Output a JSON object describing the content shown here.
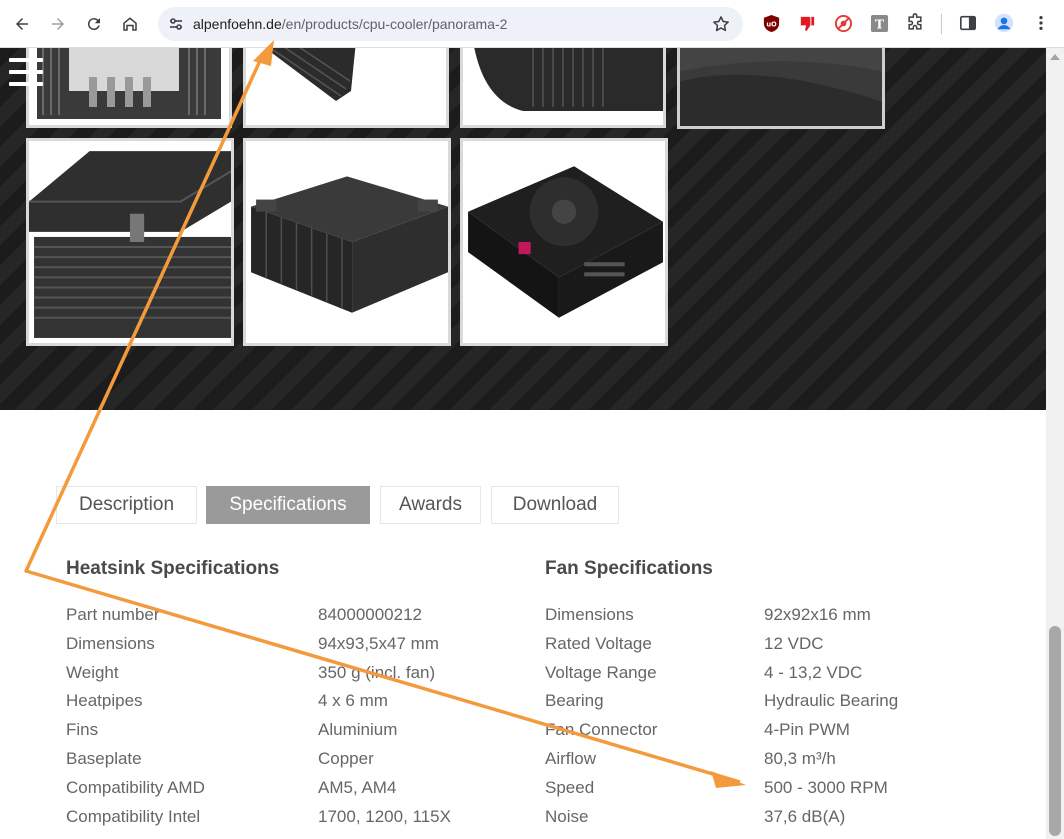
{
  "browser": {
    "url_host": "alpenfoehn.de",
    "url_path": "/en/products/cpu-cooler/panorama-2",
    "icons": [
      "back-icon",
      "forward-icon",
      "reload-icon",
      "home-icon",
      "site-info-icon",
      "bookmark-star-icon",
      "ublock-icon",
      "dislike-extension-icon",
      "blocker-extension-icon",
      "t-extension-icon",
      "extensions-puzzle-icon",
      "side-panel-icon",
      "profile-avatar-icon",
      "menu-kebab-icon"
    ]
  },
  "gallery": {
    "images": [
      "heatsink-fins-top",
      "heatsink-corner",
      "heatpipes-detail",
      "cooler-dark-detail",
      "cooler-side-view",
      "heatsink-angled",
      "cooler-on-motherboard"
    ]
  },
  "tabs": [
    {
      "label": "Description",
      "active": false
    },
    {
      "label": "Specifications",
      "active": true
    },
    {
      "label": "Awards",
      "active": false
    },
    {
      "label": "Download",
      "active": false
    }
  ],
  "heatsink": {
    "title": "Heatsink Specifications",
    "rows": [
      {
        "label": "Part number",
        "value": "84000000212"
      },
      {
        "label": "Dimensions",
        "value": "94x93,5x47 mm"
      },
      {
        "label": "Weight",
        "value": "350 g (incl. fan)"
      },
      {
        "label": "Heatpipes",
        "value": "4 x 6 mm"
      },
      {
        "label": "Fins",
        "value": "Aluminium"
      },
      {
        "label": "Baseplate",
        "value": "Copper"
      },
      {
        "label": "Compatibility AMD",
        "value": "AM5, AM4"
      },
      {
        "label": "Compatibility Intel",
        "value": "1700, 1200, 115X"
      }
    ]
  },
  "fan": {
    "title": "Fan Specifications",
    "rows": [
      {
        "label": "Dimensions",
        "value": "92x92x16 mm"
      },
      {
        "label": "Rated Voltage",
        "value": "12 VDC"
      },
      {
        "label": "Voltage Range",
        "value": "4 - 13,2 VDC"
      },
      {
        "label": "Bearing",
        "value": "Hydraulic Bearing"
      },
      {
        "label": "Fan Connector",
        "value": "4-Pin PWM"
      },
      {
        "label": "Airflow",
        "value": "80,3 m³/h"
      },
      {
        "label": "Speed",
        "value": "500 - 3000 RPM"
      },
      {
        "label": "Noise",
        "value": "37,6 dB(A)"
      }
    ]
  },
  "colors": {
    "annotation_arrow": "#f39a3d",
    "active_tab": "#9a9a9a",
    "text": "#666666"
  }
}
